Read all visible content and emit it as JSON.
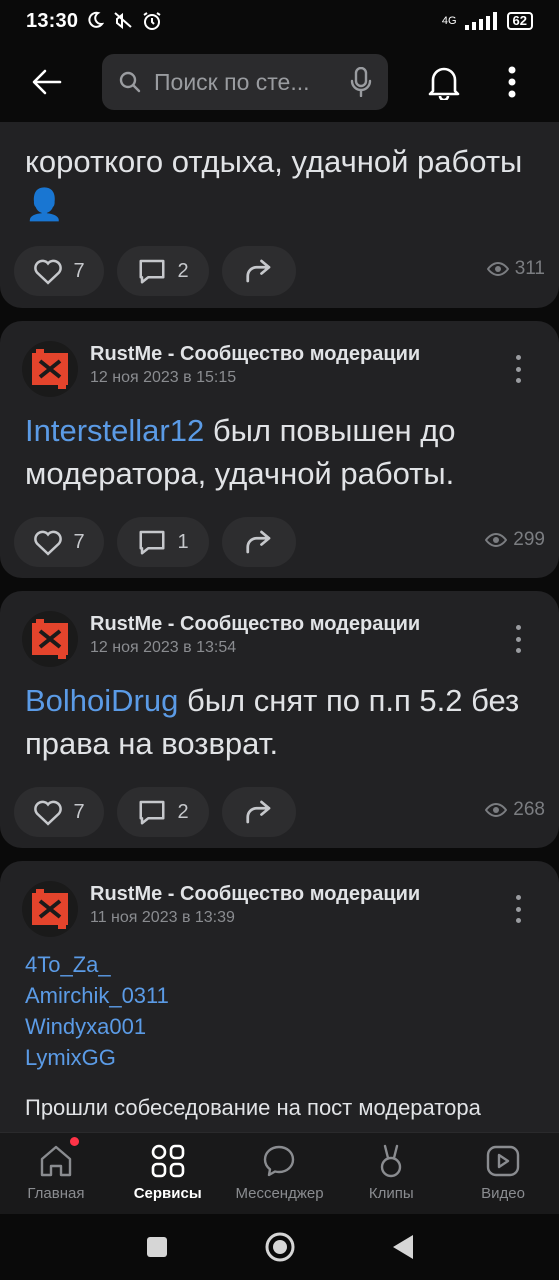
{
  "status": {
    "time": "13:30",
    "network": "4G",
    "battery": "62"
  },
  "header": {
    "search_placeholder": "Поиск по сте..."
  },
  "posts": [
    {
      "text_tail": "короткого отдыха, удачной работы 👤",
      "likes": "7",
      "comments": "2",
      "views": "311"
    },
    {
      "group": "RustMe - Сообщество модерации",
      "date": "12 ноя 2023 в 15:15",
      "mention": "Interstellar12",
      "text": " был повышен до модератора, удачной работы.",
      "likes": "7",
      "comments": "1",
      "views": "299"
    },
    {
      "group": "RustMe - Сообщество модерации",
      "date": "12 ноя 2023 в 13:54",
      "mention": "BolhoiDrug",
      "text": " был снят по п.п 5.2 без права на возврат.",
      "likes": "7",
      "comments": "2",
      "views": "268"
    },
    {
      "group": "RustMe - Сообщество модерации",
      "date": "11 ноя 2023 в 13:39",
      "links": [
        "4To_Za_",
        "Amirchik_0311",
        "Windyxa001",
        "LymixGG"
      ],
      "text": "Прошли собеседование на пост модератора"
    }
  ],
  "tabs": [
    {
      "label": "Главная",
      "icon": "home-icon"
    },
    {
      "label": "Сервисы",
      "icon": "services-icon"
    },
    {
      "label": "Мессенджер",
      "icon": "messenger-icon"
    },
    {
      "label": "Клипы",
      "icon": "clips-icon"
    },
    {
      "label": "Видео",
      "icon": "video-icon"
    }
  ],
  "colors": {
    "accent": "#5b9be6",
    "card": "#222224",
    "badge": "#ff3347"
  }
}
